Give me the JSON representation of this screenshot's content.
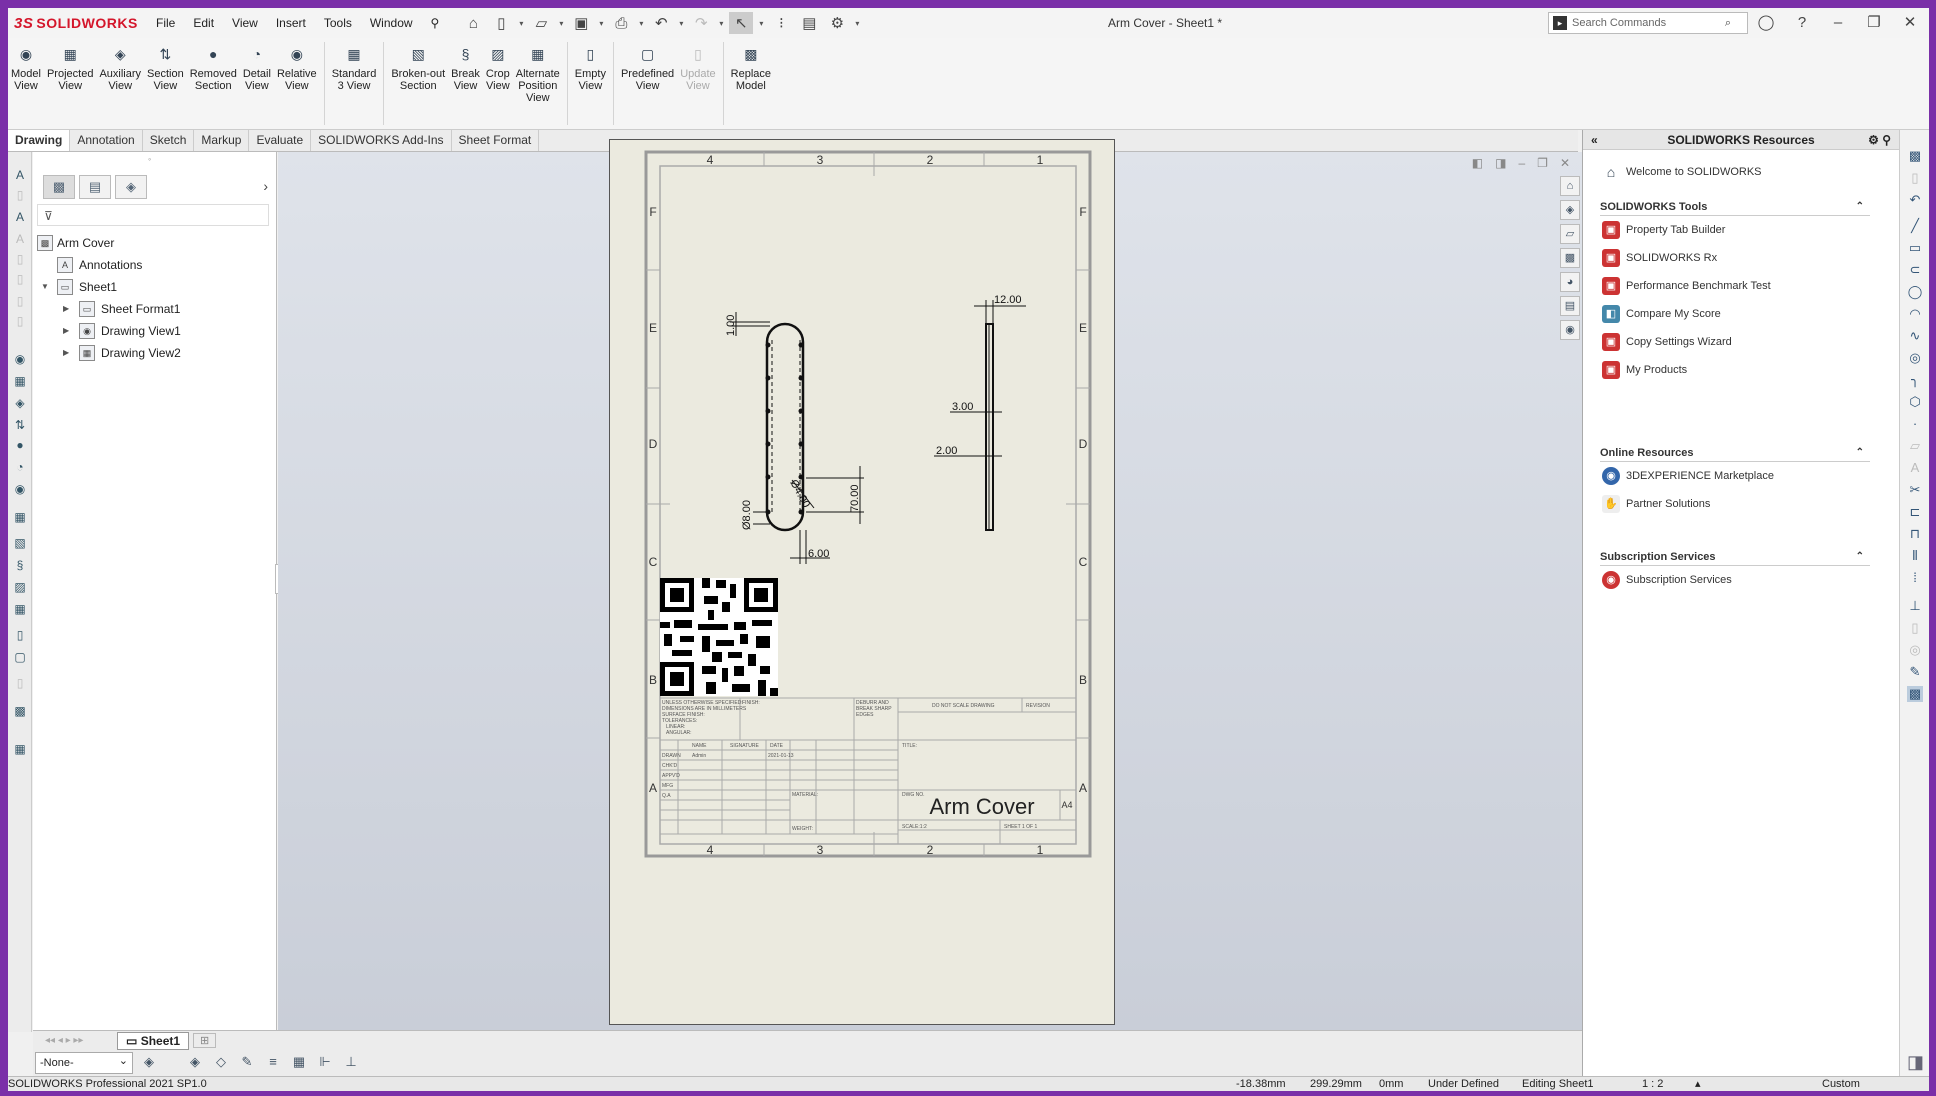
{
  "app": {
    "brand": "SOLIDWORKS",
    "brand_prefix": "3S",
    "document_title": "Arm Cover - Sheet1 *",
    "version": "SOLIDWORKS Professional 2021 SP1.0"
  },
  "menu": [
    "File",
    "Edit",
    "View",
    "Insert",
    "Tools",
    "Window"
  ],
  "search": {
    "placeholder": "Search Commands"
  },
  "ribbon": [
    {
      "label": "Model\nView",
      "icon": "model-view-icon"
    },
    {
      "label": "Projected\nView",
      "icon": "projected-view-icon"
    },
    {
      "label": "Auxiliary\nView",
      "icon": "auxiliary-view-icon"
    },
    {
      "label": "Section\nView",
      "icon": "section-view-icon"
    },
    {
      "label": "Removed\nSection",
      "icon": "removed-section-icon"
    },
    {
      "label": "Detail\nView",
      "icon": "detail-view-icon"
    },
    {
      "label": "Relative\nView",
      "icon": "relative-view-icon"
    },
    {
      "label": "Standard\n3 View",
      "icon": "standard-3-view-icon"
    },
    {
      "label": "Broken-out\nSection",
      "icon": "broken-out-section-icon"
    },
    {
      "label": "Break\nView",
      "icon": "break-view-icon"
    },
    {
      "label": "Crop\nView",
      "icon": "crop-view-icon"
    },
    {
      "label": "Alternate\nPosition\nView",
      "icon": "alternate-position-view-icon"
    },
    {
      "label": "Empty\nView",
      "icon": "empty-view-icon"
    },
    {
      "label": "Predefined\nView",
      "icon": "predefined-view-icon"
    },
    {
      "label": "Update\nView",
      "icon": "update-view-icon",
      "disabled": true
    },
    {
      "label": "Replace\nModel",
      "icon": "replace-model-icon"
    }
  ],
  "tabs": [
    "Drawing",
    "Annotation",
    "Sketch",
    "Markup",
    "Evaluate",
    "SOLIDWORKS Add-Ins",
    "Sheet Format"
  ],
  "active_tab": "Drawing",
  "tree": {
    "root": "Arm Cover",
    "annotations": "Annotations",
    "sheet": "Sheet1",
    "sheet_format": "Sheet Format1",
    "view1": "Drawing View1",
    "view2": "Drawing View2"
  },
  "drawing": {
    "col_labels": [
      "4",
      "3",
      "2",
      "1"
    ],
    "row_labels": [
      "F",
      "E",
      "D",
      "C",
      "B",
      "A"
    ],
    "dims": {
      "d1": "1.00",
      "d2": "12.00",
      "d3": "3.00",
      "d4": "2.00",
      "d5": "70.00",
      "d6": "Ø8.00",
      "d7": "Ø4.00",
      "d8": "6.00"
    },
    "title_block": {
      "part_name": "Arm Cover",
      "size": "A4",
      "unless_note": "UNLESS OTHERWISE SPECIFIED:",
      "dims_note": "DIMENSIONS ARE IN MILLIMETERS",
      "surface_finish": "SURFACE FINISH:",
      "tolerances": "TOLERANCES:",
      "linear": "LINEAR:",
      "angular": "ANGULAR:",
      "finish": "FINISH:",
      "deburr": "DEBURR AND",
      "break_sharp": "BREAK SHARP",
      "edges": "EDGES",
      "do_not_scale": "DO NOT SCALE DRAWING",
      "revision": "REVISION",
      "title": "TITLE:",
      "name_hdr": "NAME",
      "sig_hdr": "SIGNATURE",
      "date_hdr": "DATE",
      "drawn": "DRAWN",
      "drawn_name": "Admin",
      "drawn_date": "2021-01-13",
      "chkd": "CHK'D",
      "appvd": "APPV'D",
      "mfg": "MFG",
      "qa": "Q.A",
      "material": "MATERIAL:",
      "weight": "WEIGHT:",
      "dwg_no": "DWG NO.",
      "scale": "SCALE:1:2",
      "sheet_of": "SHEET 1 OF 1"
    }
  },
  "sheet_tab": "Sheet1",
  "layer": "-None-",
  "status": {
    "x": "-18.38mm",
    "y": "299.29mm",
    "z": "0mm",
    "state": "Under Defined",
    "editing": "Editing Sheet1",
    "scale": "1 : 2",
    "units": "Custom"
  },
  "taskpane": {
    "title": "SOLIDWORKS Resources",
    "welcome": "Welcome to SOLIDWORKS",
    "tools_header": "SOLIDWORKS Tools",
    "tools": [
      "Property Tab Builder",
      "SOLIDWORKS Rx",
      "Performance Benchmark Test",
      "Compare My Score",
      "Copy Settings Wizard",
      "My Products"
    ],
    "online_header": "Online Resources",
    "online": [
      "3DEXPERIENCE Marketplace",
      "Partner Solutions"
    ],
    "subs_header": "Subscription Services",
    "subs": [
      "Subscription Services"
    ]
  }
}
